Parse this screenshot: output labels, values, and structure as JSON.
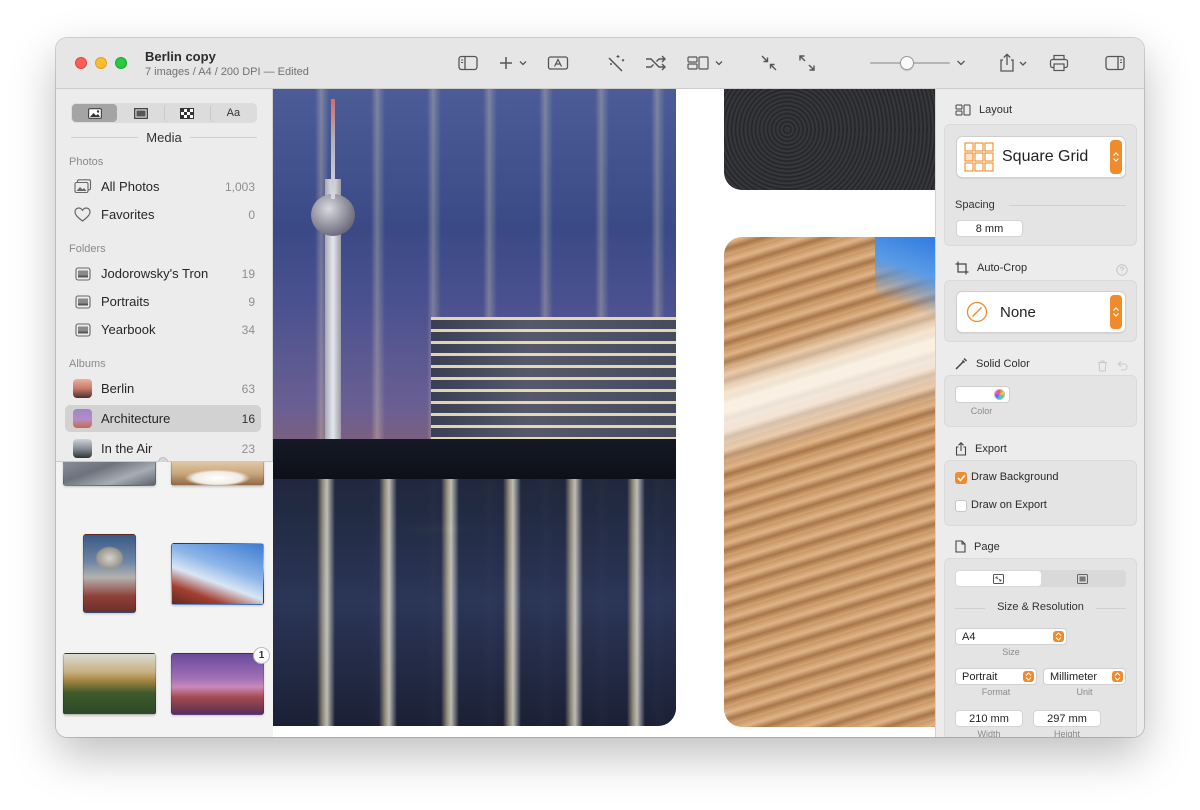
{
  "document": {
    "name": "Berlin copy",
    "subtitle": "7 images / A4 / 200 DPI — Edited"
  },
  "toolbar": {
    "icons": [
      "sidebar-toggle-icon",
      "add-icon",
      "text-box-icon",
      "magic-wand-icon",
      "shuffle-icon",
      "layout-icon",
      "shrink-icon",
      "expand-icon",
      "share-icon",
      "print-icon",
      "inspector-toggle-icon"
    ],
    "zoom_fraction": 0.45
  },
  "sidebar": {
    "tabs": [
      {
        "name": "photos-tab",
        "label": "",
        "icon": "photo-icon",
        "active": true
      },
      {
        "name": "frames-tab",
        "label": "",
        "icon": "frame-icon",
        "active": false
      },
      {
        "name": "patterns-tab",
        "label": "",
        "icon": "checker-icon",
        "active": false
      },
      {
        "name": "text-tab",
        "label": "Aa",
        "active": false
      }
    ],
    "header": "Media",
    "sections": {
      "photos": "Photos",
      "folders": "Folders",
      "albums": "Albums"
    },
    "photos": [
      {
        "label": "All Photos",
        "count": "1,003",
        "icon": "photos-stack-icon"
      },
      {
        "label": "Favorites",
        "count": "0",
        "icon": "heart-icon"
      }
    ],
    "folders": [
      {
        "label": "Jodorowsky's Tron",
        "count": "19",
        "icon": "folder-photo-icon"
      },
      {
        "label": "Portraits",
        "count": "9",
        "icon": "folder-photo-icon"
      },
      {
        "label": "Yearbook",
        "count": "34",
        "icon": "folder-photo-icon"
      }
    ],
    "albums": [
      {
        "label": "Berlin",
        "count": "63",
        "selected": false
      },
      {
        "label": "Architecture",
        "count": "16",
        "selected": true
      },
      {
        "label": "In the Air",
        "count": "23",
        "selected": false
      }
    ],
    "badge_count": "1"
  },
  "inspector": {
    "layout": {
      "title": "Layout",
      "value": "Square Grid",
      "spacing_label": "Spacing",
      "spacing_value": "8 mm"
    },
    "autocrop": {
      "title": "Auto-Crop",
      "value": "None"
    },
    "solid_color": {
      "title": "Solid Color",
      "color_caption": "Color"
    },
    "export": {
      "title": "Export",
      "draw_background": "Draw Background",
      "draw_background_checked": true,
      "draw_on_export": "Draw on Export",
      "draw_on_export_checked": false
    },
    "page": {
      "title": "Page",
      "size_resolution": "Size & Resolution",
      "size_value": "A4",
      "size_caption": "Size",
      "format_value": "Portrait",
      "format_caption": "Format",
      "unit_value": "Millimeter",
      "unit_caption": "Unit",
      "width_value": "210 mm",
      "width_caption": "Width",
      "height_value": "297 mm",
      "height_caption": "Height"
    }
  },
  "colors": {
    "accent": "#f08a2b",
    "sidebar_bg": "#ececec",
    "selection": "#d2d2d2"
  }
}
